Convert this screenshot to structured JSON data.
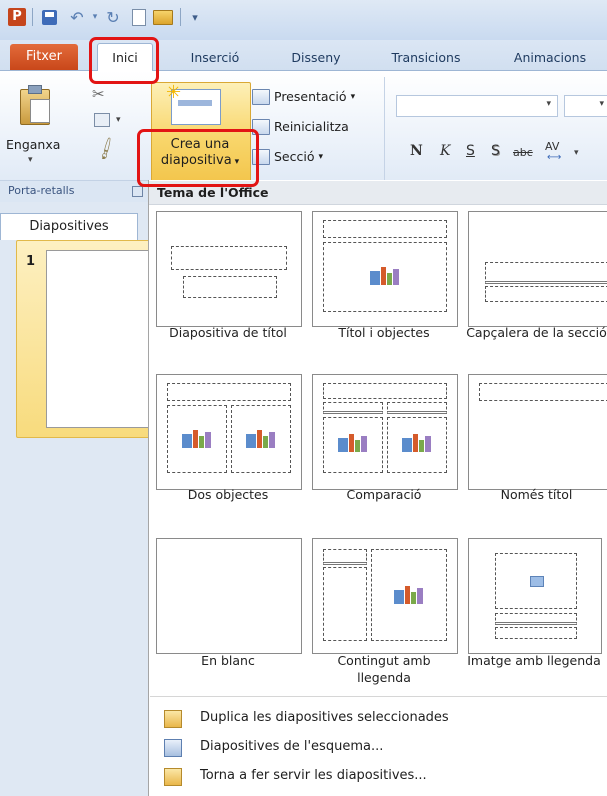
{
  "window": {
    "app_icon_letter": "P"
  },
  "tabs": [
    {
      "label": "Fitxer"
    },
    {
      "label": "Inici"
    },
    {
      "label": "Inserció"
    },
    {
      "label": "Disseny"
    },
    {
      "label": "Transicions"
    },
    {
      "label": "Animacions"
    }
  ],
  "ribbon": {
    "paste_label": "Enganxa",
    "clipboard_group": "Porta-retalls",
    "new_slide_line1": "Crea una",
    "new_slide_line2": "diapositiva",
    "layout_label": "Presentació",
    "reset_label": "Reinicialitza",
    "section_label": "Secció",
    "font_buttons": {
      "bold": "N",
      "italic": "K",
      "underline": "S",
      "shadow": "S",
      "strike": "abc",
      "spacing": "AV"
    }
  },
  "left_pane": {
    "tab_label": "Diapositives",
    "slide_number": "1"
  },
  "gallery": {
    "header": "Tema de l'Office",
    "layouts": [
      {
        "name": "Diapositiva de títol"
      },
      {
        "name": "Títol i objectes"
      },
      {
        "name": "Capçalera de la secció"
      },
      {
        "name": "Dos objectes"
      },
      {
        "name": "Comparació"
      },
      {
        "name": "Només títol"
      },
      {
        "name": "En blanc"
      },
      {
        "name": "Contingut amb llegenda"
      },
      {
        "name": "Imatge amb llegenda"
      }
    ],
    "menu": [
      {
        "label": "Duplica les diapositives seleccionades"
      },
      {
        "label": "Diapositives de l'esquema..."
      },
      {
        "label": "Torna a fer servir les diapositives..."
      }
    ]
  },
  "colors": {
    "file_tab": "#d2532a",
    "highlight_red": "#e21414",
    "new_slide_hover": "#f8d66b"
  }
}
